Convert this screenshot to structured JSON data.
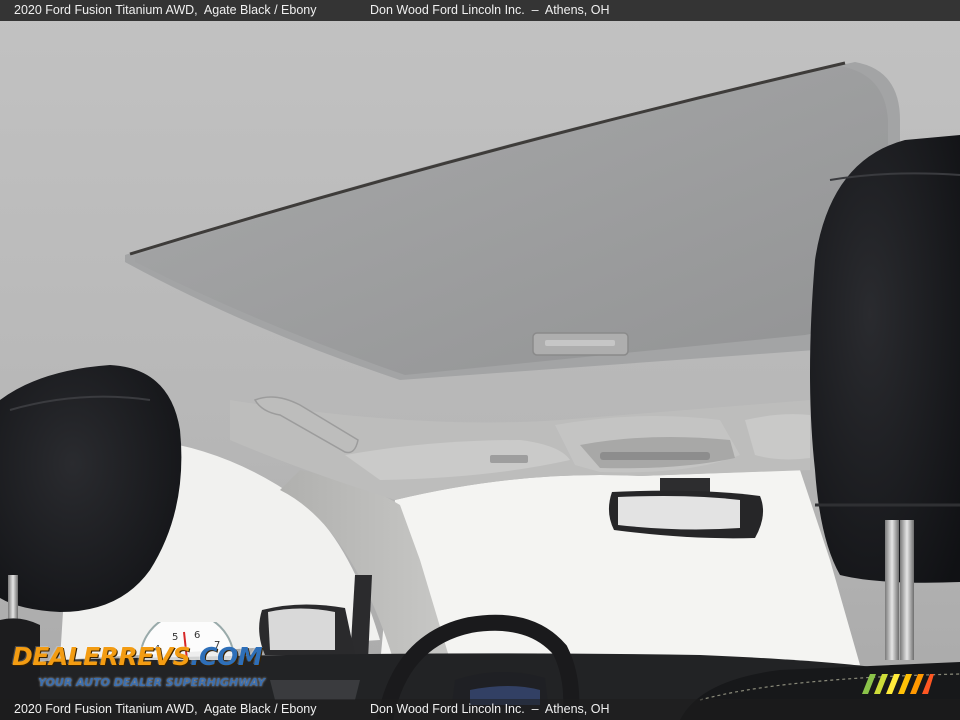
{
  "caption": {
    "vehicle": "2020 Ford Fusion Titanium AWD,",
    "color": "Agate Black / Ebony",
    "dealer": "Don Wood Ford Lincoln Inc.",
    "location": "Athens, OH"
  },
  "watermark": {
    "brand_prefix": "DEALERREVS",
    "brand_suffix": ".COM",
    "tagline": "YOUR AUTO DEALER SUPERHIGHWAY"
  },
  "colors": {
    "headliner": "#b9b9b9",
    "sunroof_shade": "#9a9b9c",
    "headrest": "#1b1c1f",
    "windshield": "#f4f4f2",
    "brand_orange": "#f39c12",
    "brand_blue": "#2e6fb8"
  }
}
